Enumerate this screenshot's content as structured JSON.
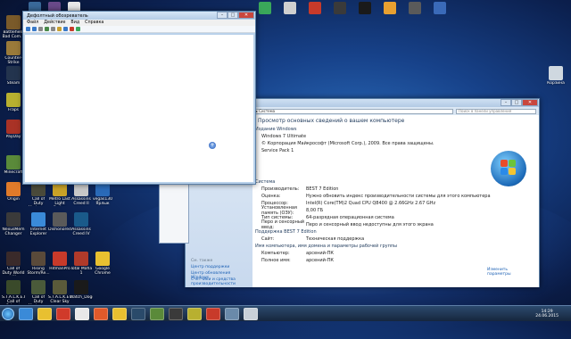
{
  "desktop_icons": [
    {
      "label": "Battlefield Bad Com...",
      "color": "#7a5a2a"
    },
    {
      "label": "Counter-Strike sourc...",
      "color": "#9a7a3a"
    },
    {
      "label": "Steam",
      "color": "#23344e"
    },
    {
      "label": "Fraps",
      "color": "#b8b030"
    },
    {
      "label": "PayDay",
      "color": "#a93226"
    },
    {
      "label": "Minecraft",
      "color": "#5a8a3a"
    },
    {
      "label": "Origin",
      "color": "#e07a2a"
    },
    {
      "label": "Call of Duty Modern ...",
      "color": "#4a4a3a"
    },
    {
      "label": "Metro Last Light Redux",
      "color": "#c9a227"
    },
    {
      "label": "Assassins Creed II",
      "color": "#c8c8c8"
    },
    {
      "label": "vegas130 Ярлык",
      "color": "#2a6ab8"
    },
    {
      "label": "NexusMem Changer",
      "color": "#3a3a3a"
    },
    {
      "label": "Internet Explorer",
      "color": "#3a8ad8"
    },
    {
      "label": "Dishonored",
      "color": "#5a5a5a"
    },
    {
      "label": "Assassins Creed IV",
      "color": "#1a5a8a"
    },
    {
      "label": "Call of Duty World at War",
      "color": "#3a2a2a"
    },
    {
      "label": "Rising Storm/Re...",
      "color": "#5a4a3a"
    },
    {
      "label": "HitmanPro",
      "color": "#c83a2a"
    },
    {
      "label": "Total Mafia 1",
      "color": "#b03a2a"
    },
    {
      "label": "Google Chrome",
      "color": "#e8c030"
    },
    {
      "label": "S.T.A.L.K.E.R. Call of Pripyat",
      "color": "#3a4a2a"
    },
    {
      "label": "Call of Duty Modern ...",
      "color": "#4a5a3a"
    },
    {
      "label": "S.T.A.L.K.E.R. Clear Sky",
      "color": "#5a5a3a"
    },
    {
      "label": "Watch_Dogs",
      "color": "#1a1a1a"
    },
    {
      "label": "Корзина",
      "color": "#cfd8e0"
    }
  ],
  "explorer": {
    "title": "Дефолтный обозреватель",
    "menu": [
      "Файл",
      "Действие",
      "Вид",
      "Справка"
    ]
  },
  "system": {
    "breadcrumb": "Система и безопасность ▸ Система",
    "search_placeholder": "Поиск в панели управления",
    "heading": "Просмотр основных сведений о вашем компьютере",
    "edition_section": "Издание Windows",
    "edition": "Windows 7 Ultimate",
    "copyright": "© Корпорация Майкрософт (Microsoft Corp.), 2009. Все права защищены.",
    "sp": "Service Pack 1",
    "system_section": "Система",
    "rows": [
      {
        "k": "Производитель:",
        "v": "BEST 7 Edition"
      },
      {
        "k": "Оценка:",
        "v": "Нужно обновить индекс производительности системы для этого компьютера"
      },
      {
        "k": "Процессор:",
        "v": "Intel(R) Core(TM)2 Quad CPU Q8400 @ 2.66GHz 2.67 GHz"
      },
      {
        "k": "Установленная память (ОЗУ):",
        "v": "8,00 ГБ"
      },
      {
        "k": "Тип системы:",
        "v": "64-разрядная операционная система"
      },
      {
        "k": "Перо и сенсорный ввод:",
        "v": "Перо и сенсорный ввод недоступны для этого экрана"
      }
    ],
    "support_section": "Поддержка BEST 7 Edition",
    "site_label": "Сайт:",
    "site_value": "Техническая поддержка",
    "name_section": "Имя компьютера, имя домена и параметры рабочей группы",
    "comp_rows": [
      {
        "k": "Компьютер:",
        "v": "арсений-ПК"
      },
      {
        "k": "Полное имя:",
        "v": "арсений-ПК"
      }
    ],
    "change_label": "Изменить параметры",
    "left_see_also": "См. также",
    "left_links": [
      "Центр поддержки",
      "Центр обновления Windows",
      "Счетчики и средства производительности"
    ]
  },
  "taskbar": {
    "clock_time": "14:29",
    "clock_date": "24.06.2015"
  }
}
